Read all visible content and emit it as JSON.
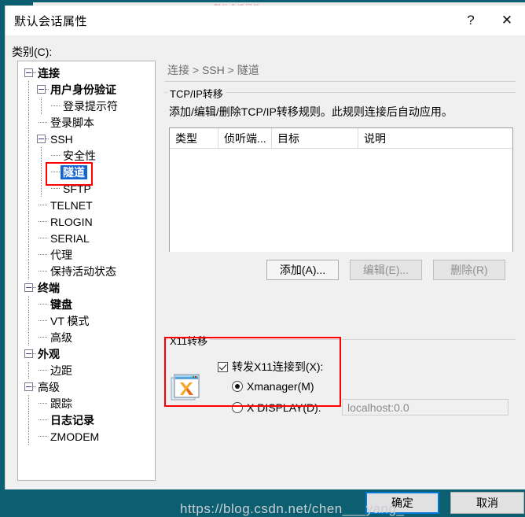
{
  "window": {
    "title": "默认会话属性",
    "help_button": "?",
    "close_button": "✕",
    "behind_title": "默认会话属性"
  },
  "sidebar": {
    "label": "类别(C):",
    "items": [
      {
        "label": "连接",
        "depth": 0,
        "bold": true,
        "expander": true,
        "selected": false
      },
      {
        "label": "用户身份验证",
        "depth": 1,
        "bold": true,
        "expander": true,
        "selected": false
      },
      {
        "label": "登录提示符",
        "depth": 2,
        "bold": false,
        "expander": false,
        "selected": false
      },
      {
        "label": "登录脚本",
        "depth": 1,
        "bold": false,
        "expander": false,
        "selected": false
      },
      {
        "label": "SSH",
        "depth": 1,
        "bold": false,
        "expander": true,
        "selected": false
      },
      {
        "label": "安全性",
        "depth": 2,
        "bold": false,
        "expander": false,
        "selected": false
      },
      {
        "label": "隧道",
        "depth": 2,
        "bold": true,
        "expander": false,
        "selected": true
      },
      {
        "label": "SFTP",
        "depth": 2,
        "bold": false,
        "expander": false,
        "selected": false
      },
      {
        "label": "TELNET",
        "depth": 1,
        "bold": false,
        "expander": false,
        "selected": false
      },
      {
        "label": "RLOGIN",
        "depth": 1,
        "bold": false,
        "expander": false,
        "selected": false
      },
      {
        "label": "SERIAL",
        "depth": 1,
        "bold": false,
        "expander": false,
        "selected": false
      },
      {
        "label": "代理",
        "depth": 1,
        "bold": false,
        "expander": false,
        "selected": false
      },
      {
        "label": "保持活动状态",
        "depth": 1,
        "bold": false,
        "expander": false,
        "selected": false
      },
      {
        "label": "终端",
        "depth": 0,
        "bold": true,
        "expander": true,
        "selected": false
      },
      {
        "label": "键盘",
        "depth": 1,
        "bold": true,
        "expander": false,
        "selected": false
      },
      {
        "label": "VT 模式",
        "depth": 1,
        "bold": false,
        "expander": false,
        "selected": false
      },
      {
        "label": "高级",
        "depth": 1,
        "bold": false,
        "expander": false,
        "selected": false
      },
      {
        "label": "外观",
        "depth": 0,
        "bold": true,
        "expander": true,
        "selected": false
      },
      {
        "label": "边距",
        "depth": 1,
        "bold": false,
        "expander": false,
        "selected": false
      },
      {
        "label": "高级",
        "depth": 0,
        "bold": false,
        "expander": true,
        "selected": false
      },
      {
        "label": "跟踪",
        "depth": 1,
        "bold": false,
        "expander": false,
        "selected": false
      },
      {
        "label": "日志记录",
        "depth": 1,
        "bold": true,
        "expander": false,
        "selected": false
      },
      {
        "label": "ZMODEM",
        "depth": 1,
        "bold": false,
        "expander": false,
        "selected": false
      }
    ]
  },
  "main": {
    "breadcrumb": "连接 > SSH > 隧道",
    "tcp_group": {
      "legend": "TCP/IP转移",
      "description": "添加/编辑/删除TCP/IP转移规则。此规则连接后自动应用。",
      "columns": [
        "类型",
        "侦听端...",
        "目标",
        "说明"
      ],
      "rows": [],
      "buttons": {
        "add": "添加(A)...",
        "edit": "编辑(E)...",
        "delete": "删除(R)"
      }
    },
    "x11_group": {
      "legend": "X11转移",
      "forward_checkbox": "转发X11连接到(X):",
      "radio_xmanager": "Xmanager(M)",
      "radio_xdisplay": "X DISPLAY(D):",
      "xdisplay_value": "localhost:0.0"
    }
  },
  "footer": {
    "ok": "确定",
    "cancel": "取消"
  },
  "watermark": "https://blog.csdn.net/chen___yang_",
  "colors": {
    "accent": "#0078d7",
    "selection": "#1464d2",
    "annotation": "#ff0000",
    "backdrop": "#0b5f70"
  }
}
